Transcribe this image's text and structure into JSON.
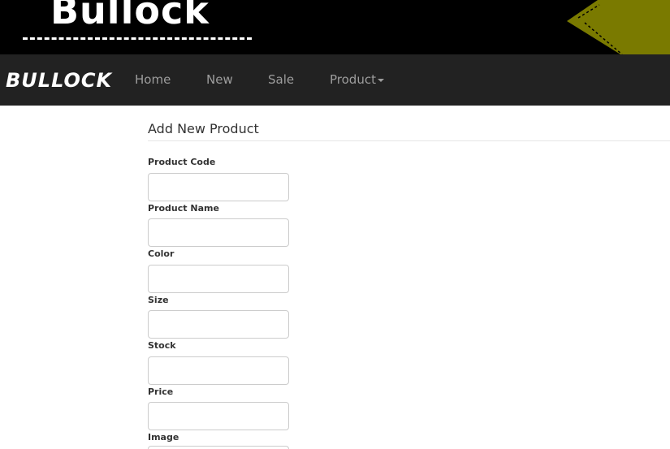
{
  "banner": {
    "logo_text": "Bullock"
  },
  "navbar": {
    "brand": "BULLOCK",
    "links": [
      "Home",
      "New",
      "Sale",
      "Product"
    ]
  },
  "form": {
    "title": "Add New Product",
    "fields": [
      {
        "label": "Product Code",
        "value": ""
      },
      {
        "label": "Product Name",
        "value": ""
      },
      {
        "label": "Color",
        "value": ""
      },
      {
        "label": "Size",
        "value": ""
      },
      {
        "label": "Stock",
        "value": ""
      },
      {
        "label": "Price",
        "value": ""
      },
      {
        "label": "Image",
        "value": ""
      }
    ]
  },
  "colors": {
    "banner_bg": "#000000",
    "navbar_bg": "#222222",
    "nav_link": "#9d9d9d",
    "tag_accent": "#7a7a00"
  }
}
